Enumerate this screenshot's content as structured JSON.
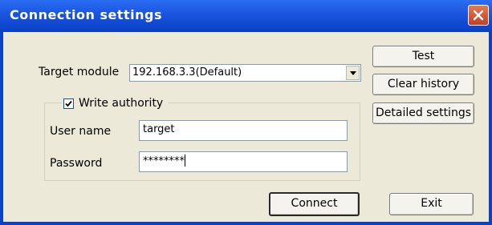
{
  "window": {
    "title": "Connection settings"
  },
  "target_module": {
    "label": "Target module",
    "value": "192.168.3.3(Default)"
  },
  "write_authority": {
    "label": "Write authority",
    "checked": true
  },
  "user_name": {
    "label": "User name",
    "value": "target"
  },
  "password": {
    "label": "Password",
    "value": "********"
  },
  "buttons": {
    "test": "Test",
    "clear_history": "Clear history",
    "detailed_settings": "Detailed settings",
    "connect": "Connect",
    "exit": "Exit"
  }
}
